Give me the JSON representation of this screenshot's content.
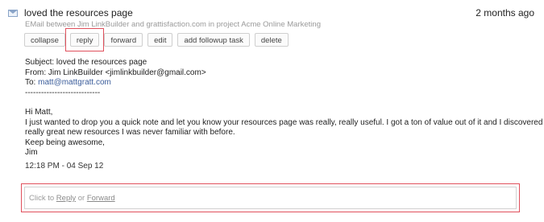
{
  "header": {
    "title": "loved the resources page",
    "date": "2 months ago",
    "subtitle": "EMail between Jim LinkBuilder and grattisfaction.com in project Acme Online Marketing"
  },
  "actions": {
    "collapse": "collapse",
    "reply": "reply",
    "forward": "forward",
    "edit": "edit",
    "add_followup": "add followup task",
    "delete": "delete"
  },
  "email": {
    "subject": "Subject: loved the resources page",
    "from": "From: Jim LinkBuilder <jimlinkbuilder@gmail.com>",
    "to_label": "To: ",
    "to_address": "matt@mattgratt.com",
    "divider": "----------------------------",
    "greeting": "Hi Matt,",
    "line1": "I just wanted to drop you a quick note and let you know your resources page was really, really useful.  I got a ton of value out of it and I discovered some",
    "line2": "really great new resources I was never familiar with before.",
    "line3": "Keep being awesome,",
    "signature": "Jim",
    "timestamp": "12:18 PM - 04 Sep 12"
  },
  "reply_box": {
    "prefix": "Click to ",
    "reply_link": "Reply",
    "middle": " or ",
    "forward_link": "Forward"
  },
  "icons": {
    "envelope": "envelope-icon"
  },
  "colors": {
    "highlight": "#e0505c",
    "link": "#3a5c9a"
  }
}
